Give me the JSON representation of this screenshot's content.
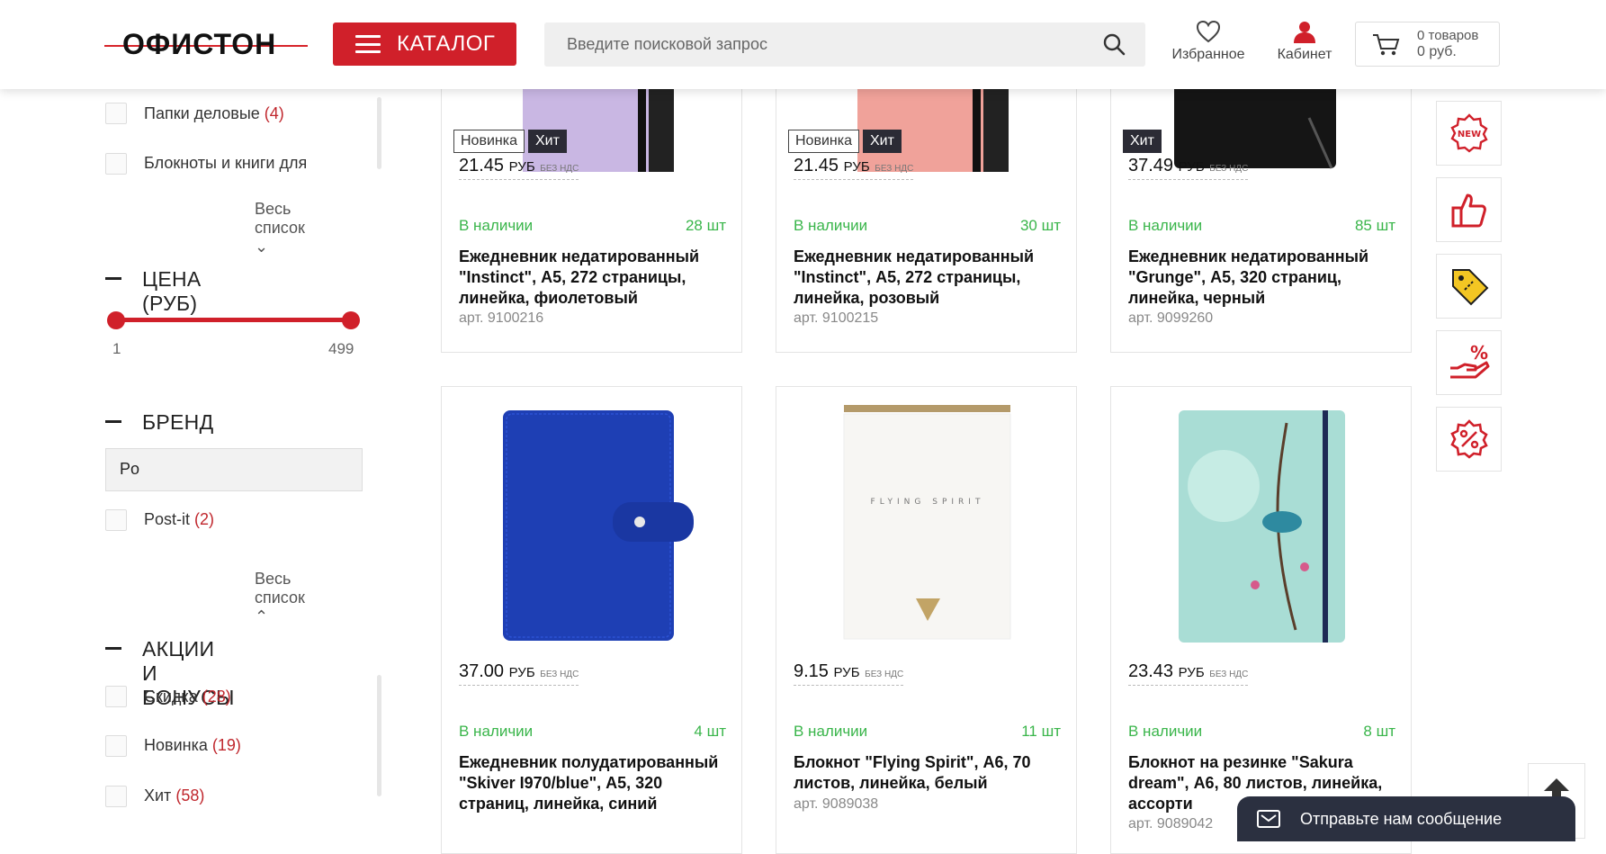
{
  "header": {
    "logo_text": "ОФИСТОН",
    "catalog_label": "КАТАЛОГ",
    "search_placeholder": "Введите поисковой запрос",
    "favorites_label": "Избранное",
    "cabinet_label": "Кабинет",
    "cart_count": "0 товаров",
    "cart_sum": "0 руб."
  },
  "sidebar": {
    "category_items": [
      {
        "label": "Папки деловые",
        "count": "(4)"
      },
      {
        "label": "Блокноты и книги для",
        "count": ""
      }
    ],
    "show_all_1": "Весь список",
    "price_title": "ЦЕНА (РУБ)",
    "price_min": "1",
    "price_max": "499",
    "price_range_selected": [
      0,
      1
    ],
    "brand_title": "БРЕНД",
    "brand_search_value": "Po",
    "brand_items": [
      {
        "label": "Post-it",
        "count": "(2)"
      }
    ],
    "show_all_2": "Весь список",
    "promo_title": "АКЦИИ И БОНУСЫ",
    "promo_items": [
      {
        "label": "Скидка",
        "count": "(28)"
      },
      {
        "label": "Новинка",
        "count": "(19)"
      },
      {
        "label": "Хит",
        "count": "(58)"
      }
    ]
  },
  "products": [
    {
      "badges": [
        "Новинка",
        "Хит"
      ],
      "price": "21.45",
      "currency": "РУБ",
      "vat": "БЕЗ НДС",
      "stock": "В наличии",
      "qty": "28 шт",
      "name": "Ежедневник недатированный \"Instinct\", А5, 272 страницы, линейка, фиолетовый",
      "art": "арт. 9100216"
    },
    {
      "badges": [
        "Новинка",
        "Хит"
      ],
      "price": "21.45",
      "currency": "РУБ",
      "vat": "БЕЗ НДС",
      "stock": "В наличии",
      "qty": "30 шт",
      "name": "Ежедневник недатированный \"Instinct\", А5, 272 страницы, линейка, розовый",
      "art": "арт. 9100215"
    },
    {
      "badges": [
        "Хит"
      ],
      "price": "37.49",
      "currency": "РУБ",
      "vat": "БЕЗ НДС",
      "stock": "В наличии",
      "qty": "85 шт",
      "name": "Ежедневник недатированный \"Grunge\", А5, 320 страниц, линейка, черный",
      "art": "арт. 9099260"
    },
    {
      "badges": [],
      "price": "37.00",
      "currency": "РУБ",
      "vat": "БЕЗ НДС",
      "stock": "В наличии",
      "qty": "4 шт",
      "name": "Ежедневник полудатированный \"Skiver I970/blue\", А5, 320 страниц, линейка, синий",
      "art": ""
    },
    {
      "badges": [],
      "price": "9.15",
      "currency": "РУБ",
      "vat": "БЕЗ НДС",
      "stock": "В наличии",
      "qty": "11 шт",
      "name": "Блокнот \"Flying Spirit\", А6, 70 листов, линейка, белый",
      "art": "арт. 9089038",
      "cover_text": "FLYING SPIRIT"
    },
    {
      "badges": [],
      "price": "23.43",
      "currency": "РУБ",
      "vat": "БЕЗ НДС",
      "stock": "В наличии",
      "qty": "8 шт",
      "name": "Блокнот на резинке \"Sakura dream\", А6, 80 листов, линейка, ассорти",
      "art": "арт. 9089042"
    }
  ],
  "right_panel": [
    "new-icon",
    "thumbs-up-icon",
    "price-tag-icon",
    "percent-hand-icon",
    "discount-badge-icon"
  ],
  "message_label": "Отправьте нам сообщение",
  "colors": {
    "brand_red": "#d0202a",
    "stock_green": "#39b54a",
    "dark": "#2b3040"
  }
}
